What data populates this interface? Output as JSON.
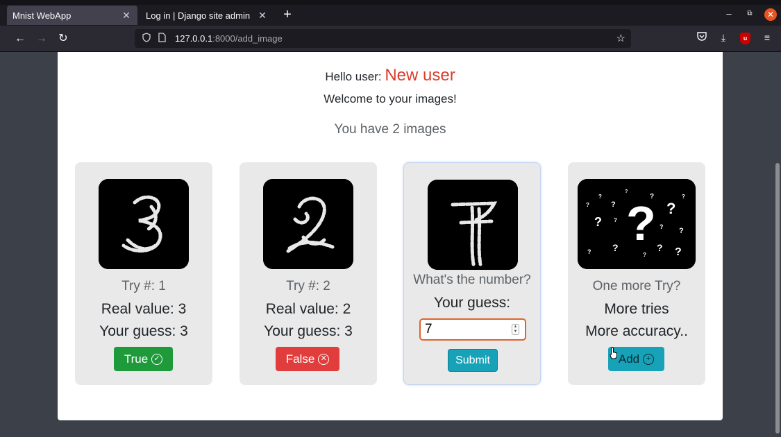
{
  "browser": {
    "tabs": [
      {
        "title": "Mnist WebApp",
        "close": "✕"
      },
      {
        "title": "Log in | Django site admin",
        "close": "✕"
      }
    ],
    "new_tab": "+",
    "url_host": "127.0.0.1",
    "url_path": ":8000/add_image"
  },
  "page": {
    "hello_prefix": "Hello user:",
    "user_name": "New user",
    "welcome": "Welcome to your images!",
    "image_count": "You have 2 images"
  },
  "cards": [
    {
      "try": "Try #: 1",
      "real": "Real value: 3",
      "guess": "Your guess: 3",
      "result_label": "True",
      "result_icon": "✓",
      "digit": "3"
    },
    {
      "try": "Try #: 2",
      "real": "Real value: 2",
      "guess": "Your guess: 3",
      "result_label": "False",
      "result_icon": "✕",
      "digit": "2"
    }
  ],
  "guess_card": {
    "question": "What's the number?",
    "prompt": "Your guess:",
    "input_value": "7",
    "submit_label": "Submit",
    "digit": "7"
  },
  "add_card": {
    "title": "One more Try?",
    "line1": "More tries",
    "line2": "More accuracy..",
    "add_label": "Add",
    "add_icon": "+"
  },
  "colors": {
    "true_button": "#1e9a3b",
    "false_button": "#e23d3d",
    "info_button": "#17a2b8",
    "user_name": "#dc3c2c"
  }
}
